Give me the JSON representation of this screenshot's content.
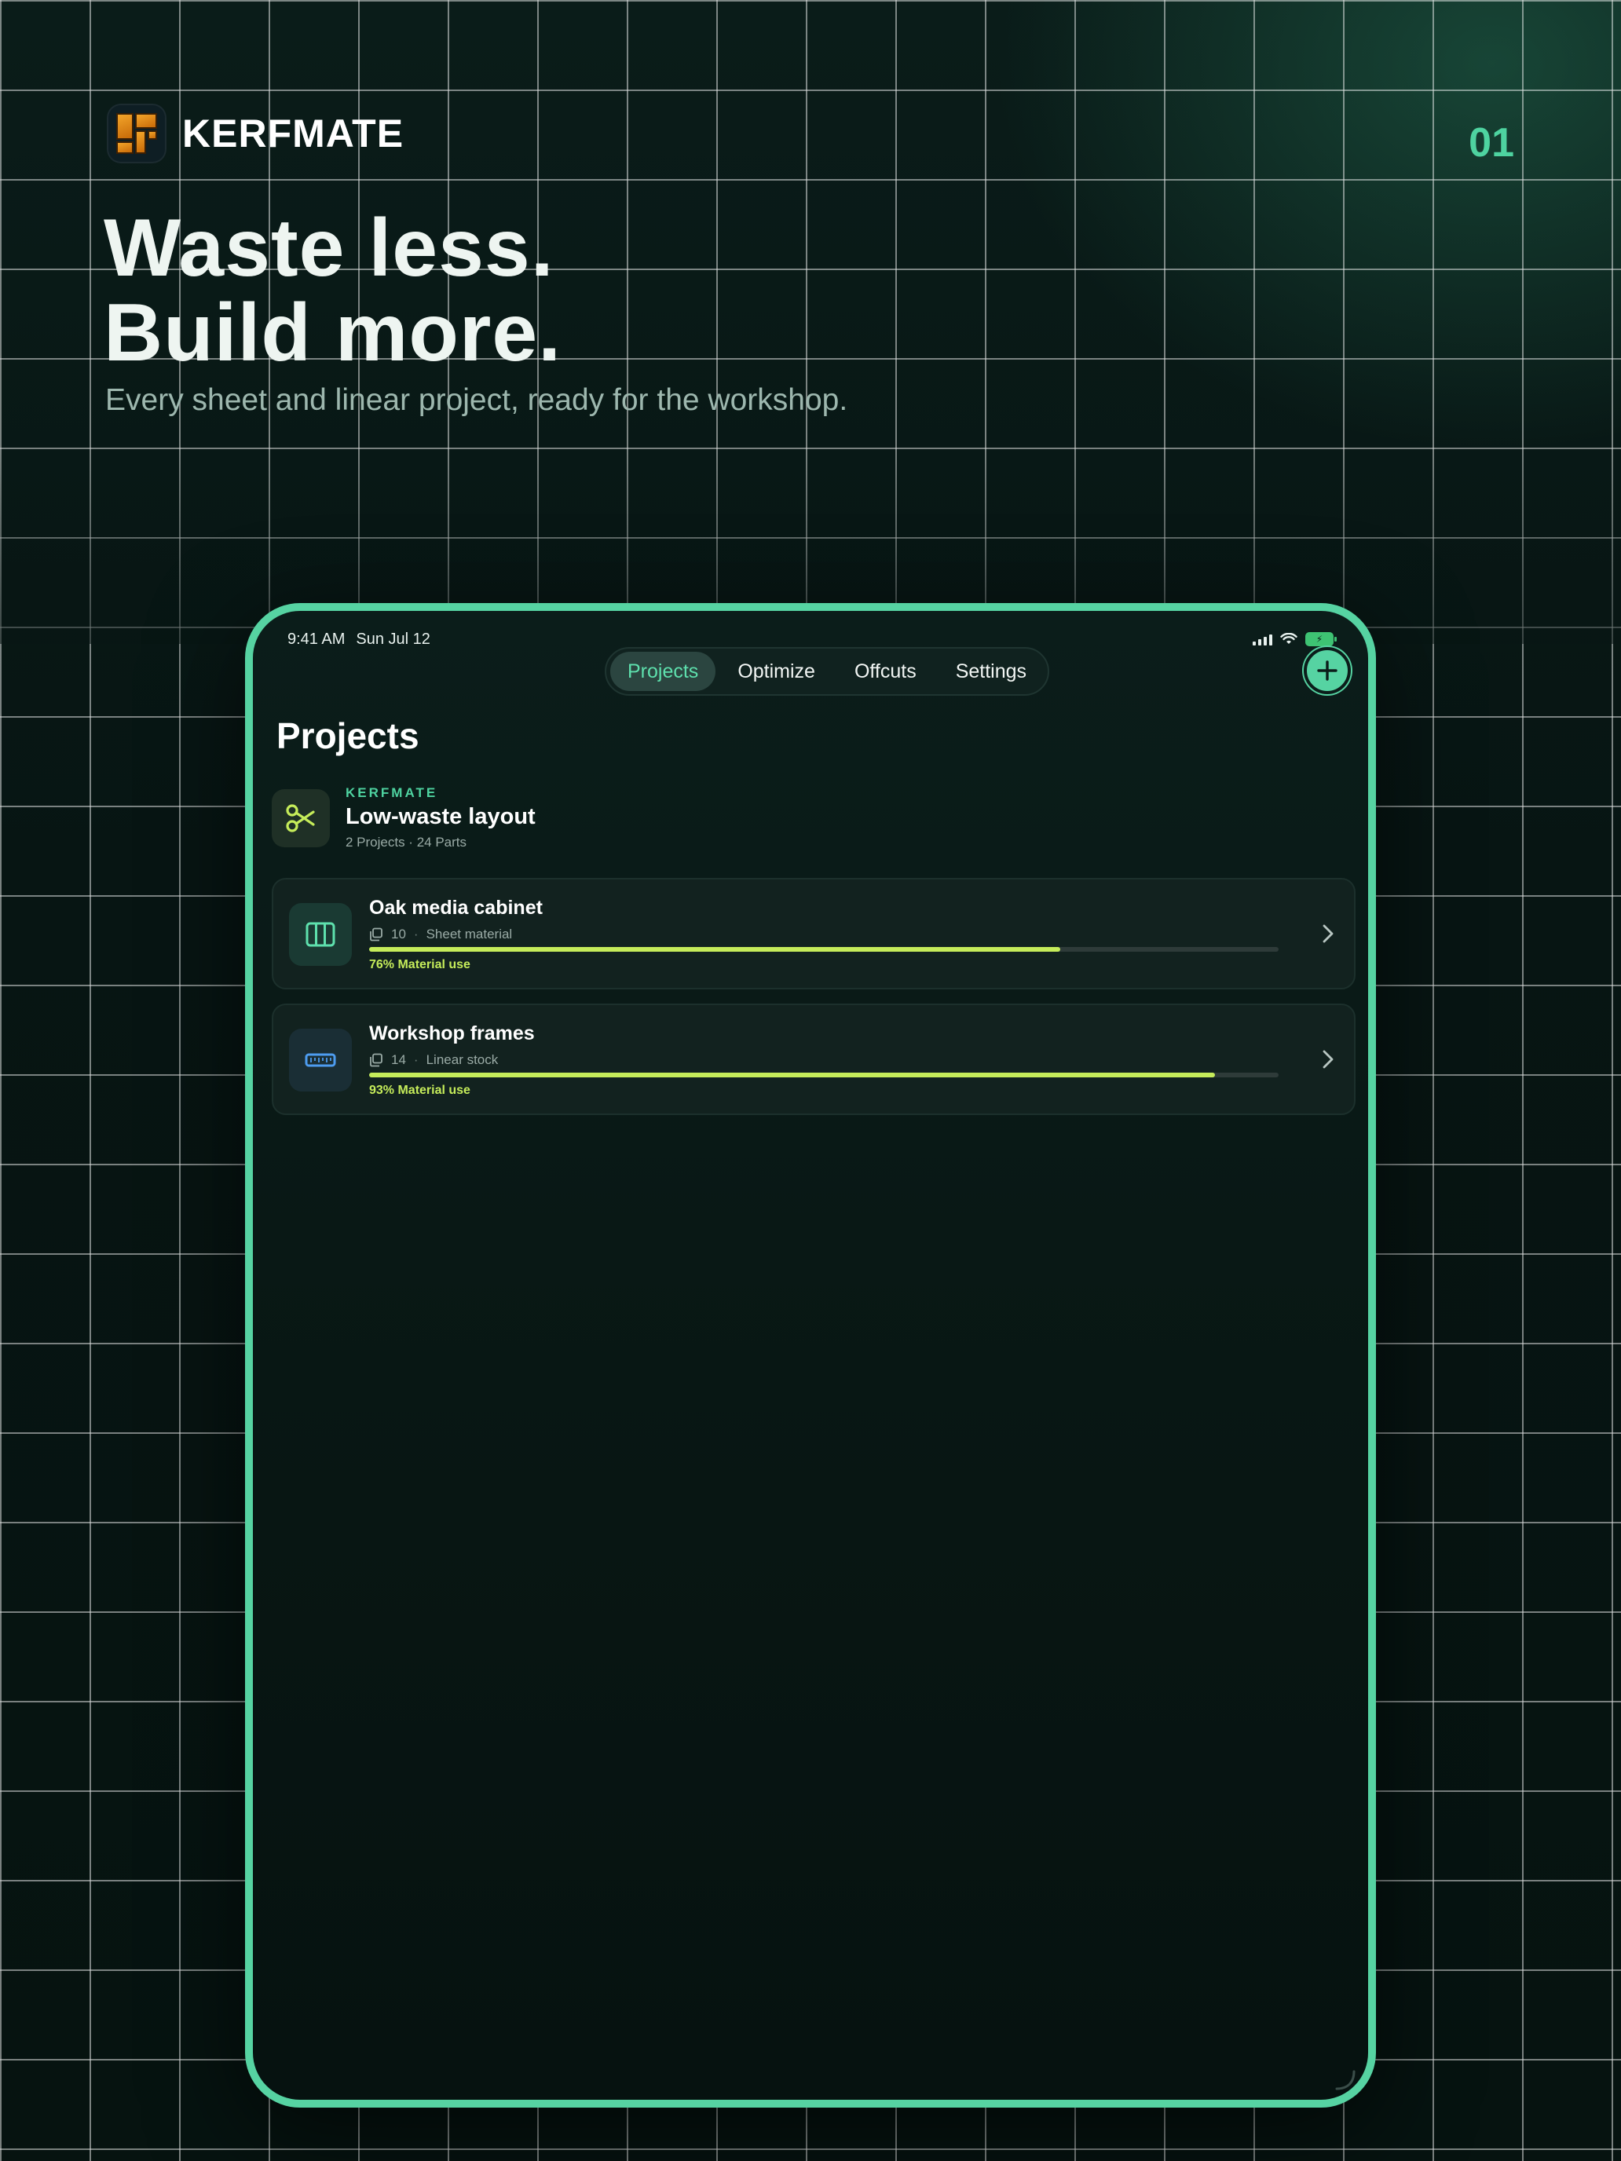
{
  "brand": {
    "name": "KERFMATE",
    "page_number": "01",
    "headline_line1": "Waste less.",
    "headline_line2": "Build more.",
    "subline": "Every sheet and linear project, ready for the workshop."
  },
  "status_bar": {
    "time": "9:41 AM",
    "date": "Sun Jul 12"
  },
  "tabs": [
    {
      "label": "Projects",
      "active": true
    },
    {
      "label": "Optimize",
      "active": false
    },
    {
      "label": "Offcuts",
      "active": false
    },
    {
      "label": "Settings",
      "active": false
    }
  ],
  "page": {
    "title": "Projects"
  },
  "summary": {
    "eyebrow": "KERFMATE",
    "title": "Low-waste layout",
    "meta": "2 Projects · 24 Parts",
    "icon": "scissors-icon"
  },
  "projects": [
    {
      "name": "Oak media cabinet",
      "parts": "10",
      "material": "Sheet material",
      "usage_label": "76% Material use",
      "usage_percent": 76,
      "icon": "sheet-layout-icon",
      "icon_color": "#5ee0ad",
      "icon_bg": "#1a3a33"
    },
    {
      "name": "Workshop frames",
      "parts": "14",
      "material": "Linear stock",
      "usage_label": "93% Material use",
      "usage_percent": 93,
      "icon": "ruler-icon",
      "icon_color": "#4d9cf0",
      "icon_bg": "#1a2e35"
    }
  ],
  "colors": {
    "accent": "#56d3a2",
    "progress": "#c5ec5a",
    "background": "#071513"
  }
}
